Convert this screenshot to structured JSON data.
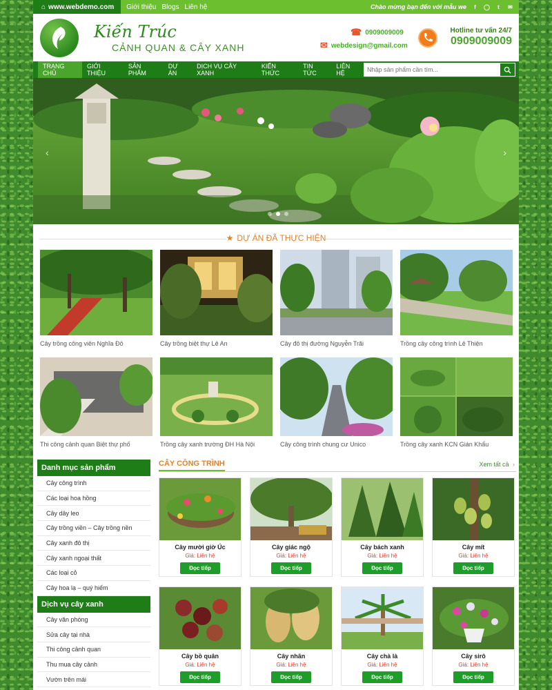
{
  "topbar": {
    "site": "www.webdemo.com",
    "links": [
      "Giới thiệu",
      "Blogs",
      "Liên hệ"
    ],
    "welcome": "Chào mừng bạn đến với mẫu we",
    "social_icons": [
      "facebook-icon",
      "instagram-icon",
      "twitter-icon",
      "mail-icon"
    ]
  },
  "header": {
    "brand": "Kiến Trúc",
    "tagline": "CẢNH QUAN & CÂY XANH",
    "phone": "0909009009",
    "email": "webdesign@gmail.com",
    "hotline_label": "Hotline tư vấn 24/7",
    "hotline_number": "0909009009"
  },
  "nav": {
    "items": [
      "TRANG CHỦ",
      "GIỚI THIỆU",
      "SẢN PHẨM",
      "DỰ ÁN",
      "DỊCH VỤ CÂY XANH",
      "KIẾN THỨC",
      "TIN TỨC",
      "LIÊN HỆ"
    ],
    "search_placeholder": "Nhập sản phẩm cần tìm..."
  },
  "projects": {
    "title": "DỰ ÁN ĐÃ THỰC HIỆN",
    "items": [
      "Cây trồng công viên Nghĩa Đô",
      "Cây trồng biệt thự Lê An",
      "Cây đô thị đường Nguyễn Trãi",
      "Trồng cây công trình Lê Thiện",
      "Thi công cảnh quan Biệt thự phố",
      "Trồng cây xanh trường ĐH Hà Nội",
      "Cây công trình chung cư Unico",
      "Trồng cây xanh KCN Gián Khẩu"
    ]
  },
  "sidebar": {
    "cat_title": "Danh mục sản phẩm",
    "categories": [
      "Cây công trình",
      "Các loại hoa hồng",
      "Cây dây leo",
      "Cây trồng viền – Cây trồng nền",
      "Cây xanh đô thị",
      "Cây xanh ngoại thất",
      "Các loại cỏ",
      "Cây hoa lạ – quý hiếm"
    ],
    "svc_title": "Dịch vụ cây xanh",
    "services": [
      "Cây văn phòng",
      "Sửa cây tại nhà",
      "Thi công cảnh quan",
      "Thu mua cây cảnh",
      "Vườn trên mái"
    ]
  },
  "products": {
    "title": "CÂY CÔNG TRÌNH",
    "view_all": "Xem tất cả",
    "price_label": "Giá: Liên hệ",
    "button_label": "Đọc tiếp",
    "items": [
      "Cây mười giờ Úc",
      "Cây giác ngộ",
      "Cây bách xanh",
      "Cây mít",
      "Cây bồ quân",
      "Cây nhãn",
      "Cây chà là",
      "Cây sirô"
    ]
  }
}
